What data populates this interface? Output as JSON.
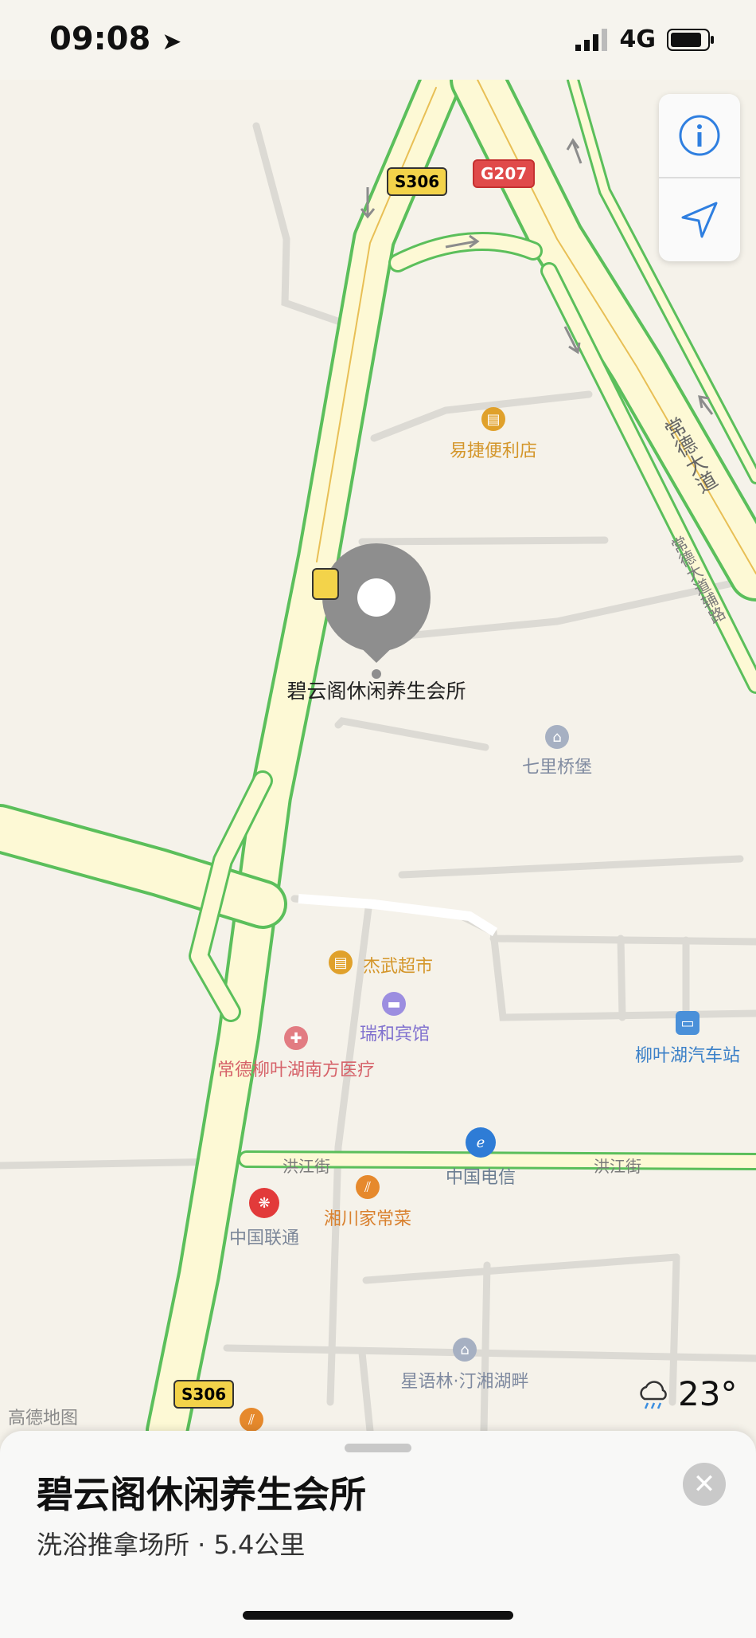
{
  "status": {
    "time": "09:08",
    "network": "4G"
  },
  "map": {
    "shields": [
      "S306",
      "G207",
      "S306"
    ],
    "roads": {
      "changde_avenue": "常德大道",
      "changde_avenue_aux": "常德大道辅路",
      "hongjiang_left": "洪江街",
      "hongjiang_right": "洪江街"
    },
    "pin_label": "碧云阁休闲养生会所",
    "pois": [
      {
        "name": "易捷便利店",
        "color": "#e0a12b"
      },
      {
        "name": "七里桥堡",
        "color": "#8a96ad"
      },
      {
        "name": "杰武超市",
        "color": "#e0a12b"
      },
      {
        "name": "瑞和宾馆",
        "color": "#8f7fd6"
      },
      {
        "name": "常德柳叶湖南方医疗",
        "color": "#dc6a70"
      },
      {
        "name": "柳叶湖汽车站",
        "color": "#4a90d9"
      },
      {
        "name": "中国电信",
        "color": "#2e7cd6"
      },
      {
        "name": "湘川家常菜",
        "color": "#e6892c"
      },
      {
        "name": "中国联通",
        "color": "#e23a3a"
      },
      {
        "name": "星语林·汀湘湖畔",
        "color": "#8a96ad"
      }
    ],
    "watermark": "高德地图"
  },
  "weather": {
    "icon": "cloud-rain-icon",
    "temp": "23°"
  },
  "sheet": {
    "title": "碧云阁休闲养生会所",
    "subtitle": "洗浴推拿场所 · 5.4公里"
  }
}
